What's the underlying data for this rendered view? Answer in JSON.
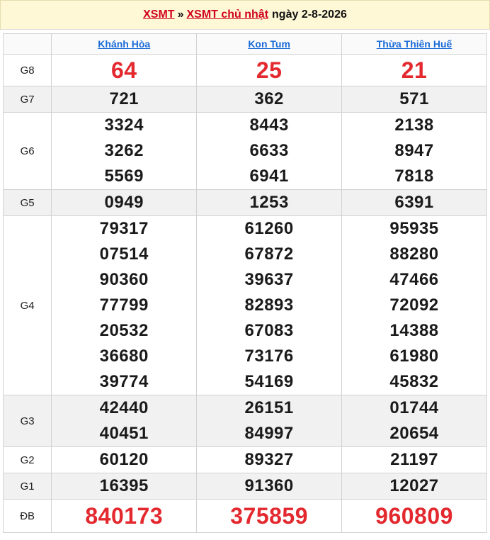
{
  "header": {
    "link1": "XSMT",
    "separator": "»",
    "link2": "XSMT chủ nhật",
    "date_text": "ngày 2-8-2026"
  },
  "columns": [
    "Khánh Hòa",
    "Kon Tum",
    "Thừa Thiên Huế"
  ],
  "colors": {
    "prize_red": "#e3282e",
    "link_blue": "#1a6bd8",
    "header_bg": "#fff8d6"
  },
  "rows": [
    {
      "label": "G8",
      "style": "big",
      "values": [
        [
          "64"
        ],
        [
          "25"
        ],
        [
          "21"
        ]
      ]
    },
    {
      "label": "G7",
      "values": [
        [
          "721"
        ],
        [
          "362"
        ],
        [
          "571"
        ]
      ]
    },
    {
      "label": "G6",
      "values": [
        [
          "3324",
          "3262",
          "5569"
        ],
        [
          "8443",
          "6633",
          "6941"
        ],
        [
          "2138",
          "8947",
          "7818"
        ]
      ]
    },
    {
      "label": "G5",
      "values": [
        [
          "0949"
        ],
        [
          "1253"
        ],
        [
          "6391"
        ]
      ]
    },
    {
      "label": "G4",
      "values": [
        [
          "79317",
          "07514",
          "90360",
          "77799",
          "20532",
          "36680",
          "39774"
        ],
        [
          "61260",
          "67872",
          "39637",
          "82893",
          "67083",
          "73176",
          "54169"
        ],
        [
          "95935",
          "88280",
          "47466",
          "72092",
          "14388",
          "61980",
          "45832"
        ]
      ]
    },
    {
      "label": "G3",
      "values": [
        [
          "42440",
          "40451"
        ],
        [
          "26151",
          "84997"
        ],
        [
          "01744",
          "20654"
        ]
      ]
    },
    {
      "label": "G2",
      "values": [
        [
          "60120"
        ],
        [
          "89327"
        ],
        [
          "21197"
        ]
      ]
    },
    {
      "label": "G1",
      "values": [
        [
          "16395"
        ],
        [
          "91360"
        ],
        [
          "12027"
        ]
      ]
    },
    {
      "label": "ĐB",
      "style": "spec",
      "values": [
        [
          "840173"
        ],
        [
          "375859"
        ],
        [
          "960809"
        ]
      ]
    }
  ]
}
